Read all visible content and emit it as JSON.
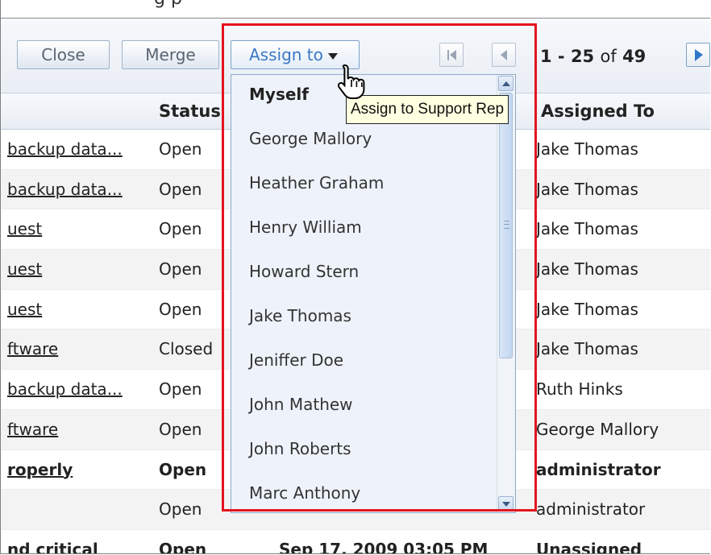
{
  "top_cut_text": "g         p",
  "toolbar": {
    "close_label": "Close",
    "merge_label": "Merge",
    "assign_label": "Assign to"
  },
  "pager": {
    "range": "1 - 25",
    "of_label": "of",
    "total": "49"
  },
  "table": {
    "headers": {
      "status": "Status",
      "assigned_to": "Assigned To"
    },
    "rows": [
      {
        "title": "backup data...",
        "status": "Open",
        "assigned": "Jake Thomas",
        "link": true,
        "bold": false
      },
      {
        "title": "backup data...",
        "status": "Open",
        "assigned": "Jake Thomas",
        "link": true,
        "bold": false
      },
      {
        "title": "uest",
        "status": "Open",
        "assigned": "Jake Thomas",
        "link": true,
        "bold": false
      },
      {
        "title": "uest",
        "status": "Open",
        "assigned": "Jake Thomas",
        "link": true,
        "bold": false
      },
      {
        "title": "uest",
        "status": "Open",
        "assigned": "Jake Thomas",
        "link": true,
        "bold": false
      },
      {
        "title": "ftware",
        "status": "Closed",
        "assigned": "Jake Thomas",
        "link": true,
        "bold": false
      },
      {
        "title": "backup data...",
        "status": "Open",
        "assigned": "Ruth Hinks",
        "link": true,
        "bold": false
      },
      {
        "title": "ftware",
        "status": "Open",
        "assigned": "George Mallory",
        "link": true,
        "bold": false
      },
      {
        "title": "roperly",
        "status": "Open",
        "assigned": "administrator",
        "link": true,
        "bold": true
      },
      {
        "title": "",
        "status": "Open",
        "assigned": "administrator",
        "link": false,
        "bold": false
      },
      {
        "title": "nd critical",
        "status": "Open",
        "date": "Sep 17, 2009 03:05 PM",
        "assigned": "Unassigned",
        "link": true,
        "bold": true
      }
    ]
  },
  "dropdown": {
    "items": [
      "Myself",
      "George Mallory",
      "Heather Graham",
      "Henry William",
      "Howard Stern",
      "Jake Thomas",
      "Jeniffer Doe",
      "John Mathew",
      "John Roberts",
      "Marc Anthony"
    ]
  },
  "tooltip": "Assign to Support Rep",
  "colors": {
    "highlight": "#e3141e",
    "accent": "#3a78c4",
    "tooltip_bg": "#ffffe1"
  }
}
